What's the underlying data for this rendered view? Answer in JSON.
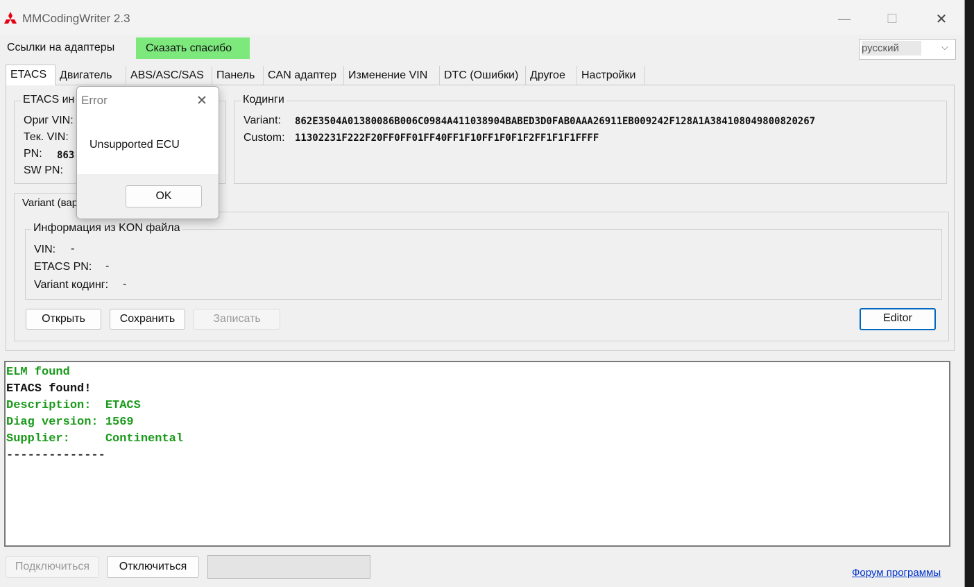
{
  "window": {
    "title": "MMCodingWriter 2.3",
    "controls": {
      "minimize": "—",
      "maximize": "☐",
      "close": "✕"
    }
  },
  "topbar": {
    "adapters_link": "Ссылки на адаптеры",
    "thanks_button": "Сказать спасибо",
    "language": "русский"
  },
  "tabs": [
    "ETACS",
    "Двигатель",
    "ABS/ASC/SAS",
    "Панель",
    "CAN адаптер",
    "Изменение VIN",
    "DTC (Ошибки)",
    "Другое",
    "Настройки"
  ],
  "etacs_info": {
    "title": "ETACS ин",
    "orig_vin_label": "Ориг VIN:",
    "tek_vin_label": "Тек. VIN:",
    "pn_label": "PN:",
    "pn_value": "863",
    "sw_pn_label": "SW PN:"
  },
  "codings": {
    "title": "Кодинги",
    "variant_label": "Variant:",
    "variant_value": "862E3504A01380086B006C0984A411038904BABED3D0FAB0AAA26911EB009242F128A1A384108049800820267",
    "custom_label": "Custom:",
    "custom_value": "11302231F222F20FF0FF01FF40FF1F10FF1F0F1F2FF1F1F1FFFF"
  },
  "subtab": {
    "label": "Variant (вар"
  },
  "kon_info": {
    "title": "Информация из KON файла",
    "vin_label": "VIN:",
    "vin_value": "-",
    "etacs_pn_label": "ETACS PN:",
    "etacs_pn_value": "-",
    "variant_label": "Variant кодинг:",
    "variant_value": "-"
  },
  "actions": {
    "open": "Открыть",
    "save": "Сохранить",
    "write": "Записать",
    "editor": "Editor"
  },
  "log": [
    {
      "text": "ELM found",
      "color": "#1a9a1a"
    },
    {
      "text": "ETACS found!",
      "color": "#111111"
    },
    {
      "text": "Description:  ETACS",
      "color": "#1a9a1a"
    },
    {
      "text": "Diag version: 1569",
      "color": "#1a9a1a"
    },
    {
      "text": "Supplier:     Continental",
      "color": "#1a9a1a"
    },
    {
      "text": "--------------",
      "color": "#111111"
    }
  ],
  "bottom": {
    "connect": "Подключиться",
    "disconnect": "Отключиться",
    "forum_link": "Форум программы"
  },
  "dialog": {
    "title": "Error",
    "message": "Unsupported ECU",
    "ok": "OK",
    "close": "✕"
  },
  "colors": {
    "thanks_bg": "#7de97d",
    "link": "#0033cc",
    "log_green": "#1a9a1a",
    "accent": "#0067c0"
  }
}
